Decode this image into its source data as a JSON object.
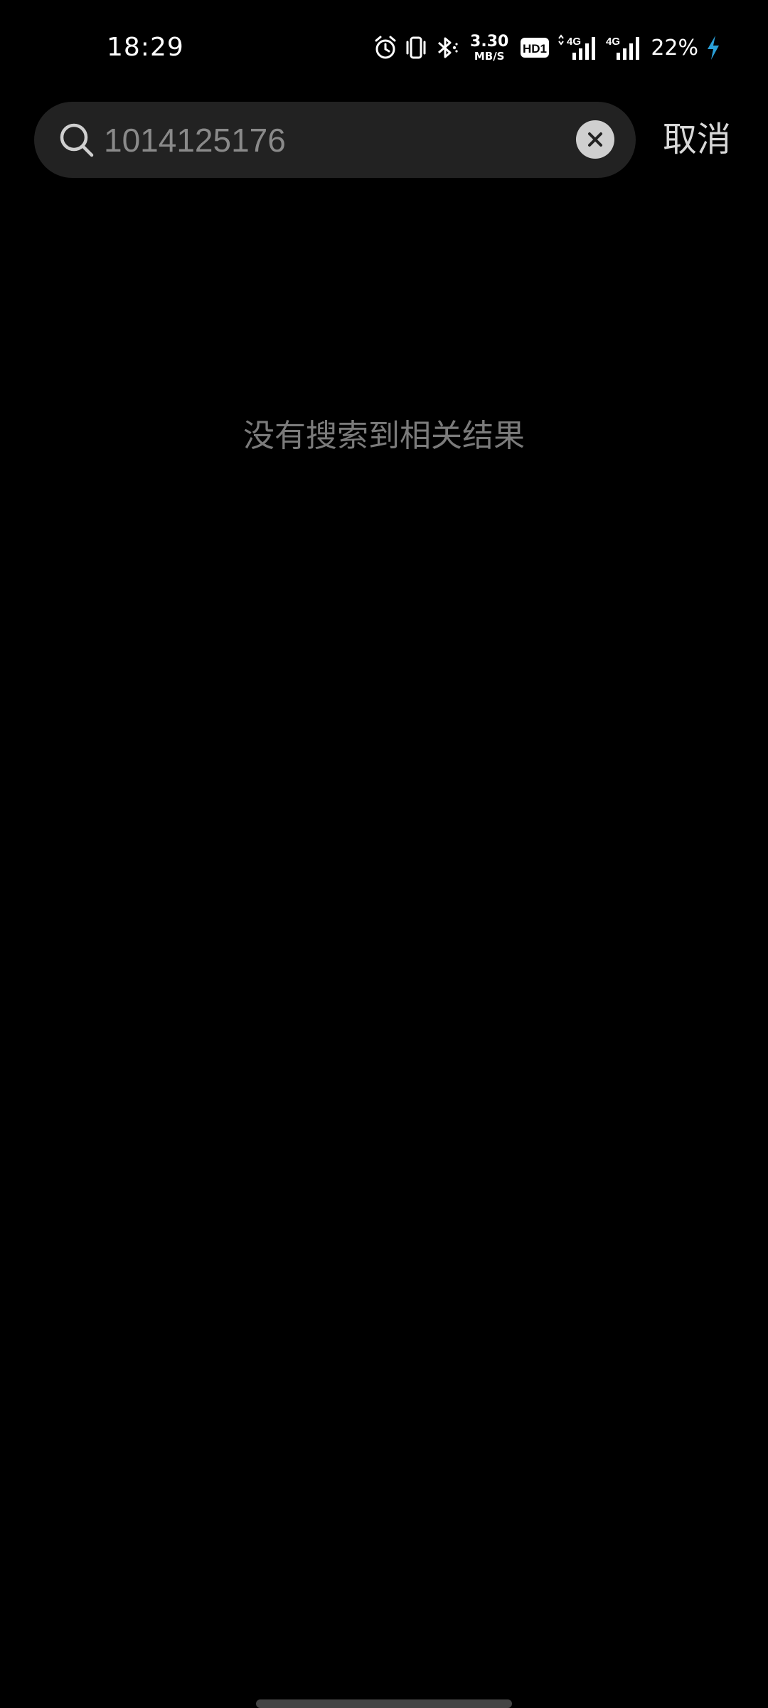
{
  "status_bar": {
    "time": "18:29",
    "speed_value": "3.30",
    "speed_unit": "MB/S",
    "hd_label": "HD1",
    "sim1_network": "4G",
    "sim2_network": "4G",
    "battery_percent": "22%",
    "icons": [
      "alarm-icon",
      "vibrate-icon",
      "bluetooth-icon",
      "hd-voice-icon",
      "signal-icon",
      "signal-icon",
      "charging-icon"
    ]
  },
  "search": {
    "value": "1014125176",
    "cancel_label": "取消"
  },
  "results": {
    "empty_message": "没有搜索到相关结果"
  },
  "colors": {
    "background": "#000000",
    "search_box": "#222222",
    "charging_accent": "#2a9fd8"
  }
}
